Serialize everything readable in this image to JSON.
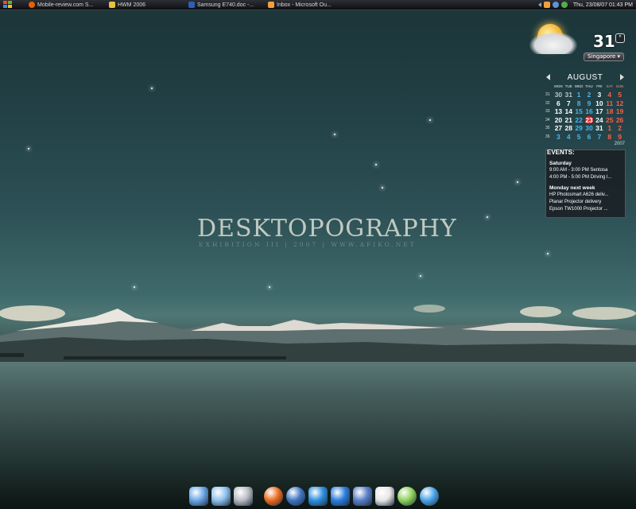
{
  "taskbar": {
    "tasks": [
      {
        "label": "Mobile-review.com S...",
        "icon": "firefox-icon",
        "color": "#e66000"
      },
      {
        "label": "HWM 2006",
        "icon": "folder-icon",
        "color": "#e8c23a"
      },
      {
        "label": "Samsung E740.doc -...",
        "icon": "word-doc-icon",
        "color": "#2b5fb8"
      },
      {
        "label": "Inbox - Microsoft Ou...",
        "icon": "outlook-icon",
        "color": "#f2a13a"
      }
    ],
    "clock": "Thu, 23/08/07 01:43 PM"
  },
  "weather": {
    "temperature": "31",
    "unit": "°",
    "city": "Singapore ▾",
    "icon": "partly-cloudy-icon"
  },
  "calendar": {
    "month": "AUGUST",
    "weekdays": [
      "MON",
      "TUE",
      "WED",
      "THU",
      "FRI",
      "SAT",
      "SUN"
    ],
    "weeks": [
      "31",
      "32",
      "33",
      "34",
      "35",
      "36"
    ],
    "days": [
      [
        "30",
        "31",
        "1",
        "2",
        "3",
        "4",
        "5"
      ],
      [
        "6",
        "7",
        "8",
        "9",
        "10",
        "11",
        "12"
      ],
      [
        "13",
        "14",
        "15",
        "16",
        "17",
        "18",
        "19"
      ],
      [
        "20",
        "21",
        "22",
        "23",
        "24",
        "25",
        "26"
      ],
      [
        "27",
        "28",
        "29",
        "30",
        "31",
        "1",
        "2"
      ],
      [
        "3",
        "4",
        "5",
        "6",
        "7",
        "8",
        "9"
      ]
    ],
    "today": "23",
    "year": "2007"
  },
  "events": {
    "title": "EVENTS:",
    "groups": [
      {
        "heading": "Saturday",
        "items": [
          "9:00 AM - 3:00 PM Sentosa",
          "4:00 PM - 5:00 PM Driving l..."
        ]
      },
      {
        "heading": "Monday next week",
        "items": [
          "HP Photosmart A626 deliv...",
          "Planar Projector delivery",
          "Epson TW1000 Projector ..."
        ]
      }
    ]
  },
  "wallpaper": {
    "title": "DESKTOPOGRAPHY",
    "subtitle": "EXHIBITION III | 2007 | WWW.AFIKO.NET"
  },
  "dock": {
    "items": [
      {
        "name": "finder-icon",
        "color": "#6aa7e8"
      },
      {
        "name": "folder-icon",
        "color": "#8fc0ef"
      },
      {
        "name": "trash-icon",
        "color": "#b8bcc2"
      },
      {
        "name": "firefox-icon",
        "color": "#e86a1c"
      },
      {
        "name": "thunderbird-icon",
        "color": "#3e74c0"
      },
      {
        "name": "winamp-icon",
        "color": "#2e8fe0"
      },
      {
        "name": "internet-explorer-icon",
        "color": "#2a7de0"
      },
      {
        "name": "mail-stamp-icon",
        "color": "#5a7fc8"
      },
      {
        "name": "notes-icon",
        "color": "#e6e6e6"
      },
      {
        "name": "itunes-icon",
        "color": "#8cd05a"
      },
      {
        "name": "messenger-icon",
        "color": "#49a2e6"
      }
    ]
  }
}
